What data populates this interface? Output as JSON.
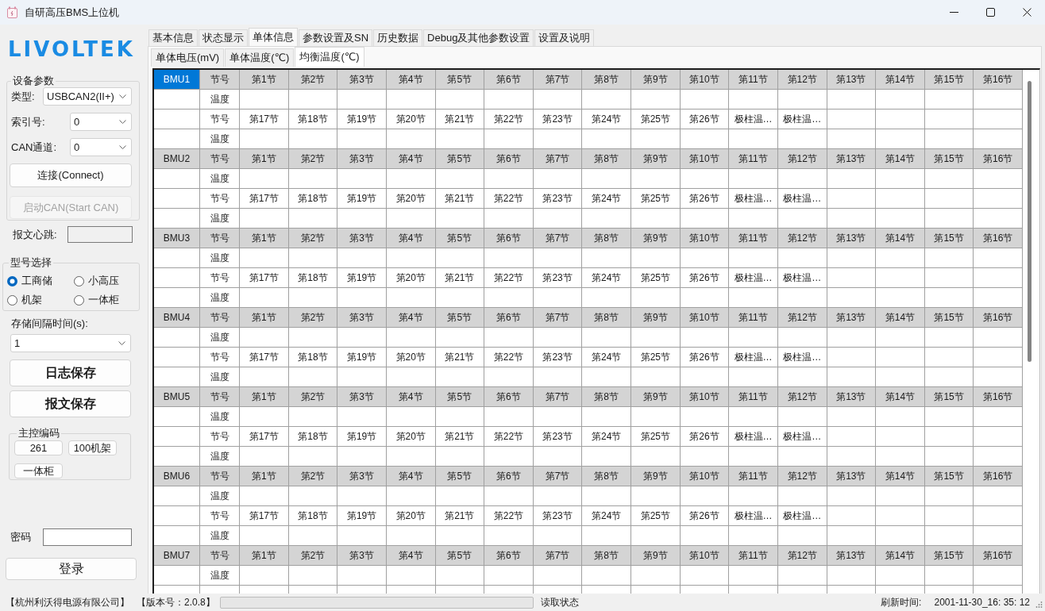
{
  "window": {
    "title": "自研高压BMS上位机"
  },
  "sidebar": {
    "logo": "LIVOLTEK",
    "device_params": {
      "title": "设备参数",
      "fields": [
        {
          "label": "类型:",
          "value": "USBCAN2(II+)"
        },
        {
          "label": "索引号:",
          "value": "0"
        },
        {
          "label": "CAN通道:",
          "value": "0"
        }
      ],
      "buttons": [
        {
          "label": "连接(Connect)",
          "disabled": false
        },
        {
          "label": "启动CAN(Start CAN)",
          "disabled": true
        }
      ]
    },
    "heartbeat": {
      "label": "报文心跳:"
    },
    "model_select": {
      "title": "型号选择",
      "options": [
        {
          "label": "工商储",
          "selected": true
        },
        {
          "label": "小高压",
          "selected": false
        },
        {
          "label": "机架",
          "selected": false
        },
        {
          "label": "一体柜",
          "selected": false
        }
      ]
    },
    "interval": {
      "label": "存储间隔时间(s):",
      "value": "1"
    },
    "save_buttons": [
      "日志保存",
      "报文保存"
    ],
    "master_code": {
      "title": "主控编码",
      "buttons": [
        "261",
        "100机架",
        "一体柜"
      ]
    },
    "password": {
      "label": "密码"
    },
    "login_button": "登录"
  },
  "tabs": [
    {
      "label": "基本信息",
      "selected": false
    },
    {
      "label": "状态显示",
      "selected": false
    },
    {
      "label": "单体信息",
      "selected": true
    },
    {
      "label": "参数设置及SN",
      "selected": false
    },
    {
      "label": "历史数据",
      "selected": false
    },
    {
      "label": "Debug及其他参数设置",
      "selected": false
    },
    {
      "label": "设置及说明",
      "selected": false
    }
  ],
  "subtabs": [
    {
      "label": "单体电压(mV)",
      "selected": false
    },
    {
      "label": "单体温度(℃)",
      "selected": false
    },
    {
      "label": "均衡温度(℃)",
      "selected": true
    }
  ],
  "table": {
    "blocks": [
      {
        "name": "BMU1",
        "selected": true,
        "rows": [
          {
            "kind": "header",
            "cells": [
              "节号",
              "第1节",
              "第2节",
              "第3节",
              "第4节",
              "第5节",
              "第6节",
              "第7节",
              "第8节",
              "第9节",
              "第10节",
              "第11节",
              "第12节",
              "第13节",
              "第14节",
              "第15节",
              "第16节"
            ]
          },
          {
            "kind": "data",
            "cells": [
              "温度"
            ]
          },
          {
            "kind": "data",
            "cells": [
              "节号",
              "第17节",
              "第18节",
              "第19节",
              "第20节",
              "第21节",
              "第22节",
              "第23节",
              "第24节",
              "第25节",
              "第26节",
              "极柱温…",
              "极柱温…"
            ]
          },
          {
            "kind": "data",
            "cells": [
              "温度"
            ]
          }
        ]
      },
      {
        "name": "BMU2",
        "selected": false,
        "rows": [
          {
            "kind": "header",
            "cells": [
              "节号",
              "第1节",
              "第2节",
              "第3节",
              "第4节",
              "第5节",
              "第6节",
              "第7节",
              "第8节",
              "第9节",
              "第10节",
              "第11节",
              "第12节",
              "第13节",
              "第14节",
              "第15节",
              "第16节"
            ]
          },
          {
            "kind": "data",
            "cells": [
              "温度"
            ]
          },
          {
            "kind": "data",
            "cells": [
              "节号",
              "第17节",
              "第18节",
              "第19节",
              "第20节",
              "第21节",
              "第22节",
              "第23节",
              "第24节",
              "第25节",
              "第26节",
              "极柱温…",
              "极柱温…"
            ]
          },
          {
            "kind": "data",
            "cells": [
              "温度"
            ]
          }
        ]
      },
      {
        "name": "BMU3",
        "selected": false,
        "rows": [
          {
            "kind": "header",
            "cells": [
              "节号",
              "第1节",
              "第2节",
              "第3节",
              "第4节",
              "第5节",
              "第6节",
              "第7节",
              "第8节",
              "第9节",
              "第10节",
              "第11节",
              "第12节",
              "第13节",
              "第14节",
              "第15节",
              "第16节"
            ]
          },
          {
            "kind": "data",
            "cells": [
              "温度"
            ]
          },
          {
            "kind": "data",
            "cells": [
              "节号",
              "第17节",
              "第18节",
              "第19节",
              "第20节",
              "第21节",
              "第22节",
              "第23节",
              "第24节",
              "第25节",
              "第26节",
              "极柱温…",
              "极柱温…"
            ]
          },
          {
            "kind": "data",
            "cells": [
              "温度"
            ]
          }
        ]
      },
      {
        "name": "BMU4",
        "selected": false,
        "rows": [
          {
            "kind": "header",
            "cells": [
              "节号",
              "第1节",
              "第2节",
              "第3节",
              "第4节",
              "第5节",
              "第6节",
              "第7节",
              "第8节",
              "第9节",
              "第10节",
              "第11节",
              "第12节",
              "第13节",
              "第14节",
              "第15节",
              "第16节"
            ]
          },
          {
            "kind": "data",
            "cells": [
              "温度"
            ]
          },
          {
            "kind": "data",
            "cells": [
              "节号",
              "第17节",
              "第18节",
              "第19节",
              "第20节",
              "第21节",
              "第22节",
              "第23节",
              "第24节",
              "第25节",
              "第26节",
              "极柱温…",
              "极柱温…"
            ]
          },
          {
            "kind": "data",
            "cells": [
              "温度"
            ]
          }
        ]
      },
      {
        "name": "BMU5",
        "selected": false,
        "rows": [
          {
            "kind": "header",
            "cells": [
              "节号",
              "第1节",
              "第2节",
              "第3节",
              "第4节",
              "第5节",
              "第6节",
              "第7节",
              "第8节",
              "第9节",
              "第10节",
              "第11节",
              "第12节",
              "第13节",
              "第14节",
              "第15节",
              "第16节"
            ]
          },
          {
            "kind": "data",
            "cells": [
              "温度"
            ]
          },
          {
            "kind": "data",
            "cells": [
              "节号",
              "第17节",
              "第18节",
              "第19节",
              "第20节",
              "第21节",
              "第22节",
              "第23节",
              "第24节",
              "第25节",
              "第26节",
              "极柱温…",
              "极柱温…"
            ]
          },
          {
            "kind": "data",
            "cells": [
              "温度"
            ]
          }
        ]
      },
      {
        "name": "BMU6",
        "selected": false,
        "rows": [
          {
            "kind": "header",
            "cells": [
              "节号",
              "第1节",
              "第2节",
              "第3节",
              "第4节",
              "第5节",
              "第6节",
              "第7节",
              "第8节",
              "第9节",
              "第10节",
              "第11节",
              "第12节",
              "第13节",
              "第14节",
              "第15节",
              "第16节"
            ]
          },
          {
            "kind": "data",
            "cells": [
              "温度"
            ]
          },
          {
            "kind": "data",
            "cells": [
              "节号",
              "第17节",
              "第18节",
              "第19节",
              "第20节",
              "第21节",
              "第22节",
              "第23节",
              "第24节",
              "第25节",
              "第26节",
              "极柱温…",
              "极柱温…"
            ]
          },
          {
            "kind": "data",
            "cells": [
              "温度"
            ]
          }
        ]
      },
      {
        "name": "BMU7",
        "selected": false,
        "rows": [
          {
            "kind": "header",
            "cells": [
              "节号",
              "第1节",
              "第2节",
              "第3节",
              "第4节",
              "第5节",
              "第6节",
              "第7节",
              "第8节",
              "第9节",
              "第10节",
              "第11节",
              "第12节",
              "第13节",
              "第14节",
              "第15节",
              "第16节"
            ]
          },
          {
            "kind": "data",
            "cells": [
              "温度"
            ]
          }
        ]
      }
    ]
  },
  "status_bar": {
    "company": "【杭州利沃得电源有限公司】",
    "version": "【版本号：2.0.8】",
    "progress": {
      "level": 0
    },
    "status": "读取状态",
    "refresh_label": "刷新时间:",
    "refresh_time": "2001-11-30_16: 35: 12"
  }
}
